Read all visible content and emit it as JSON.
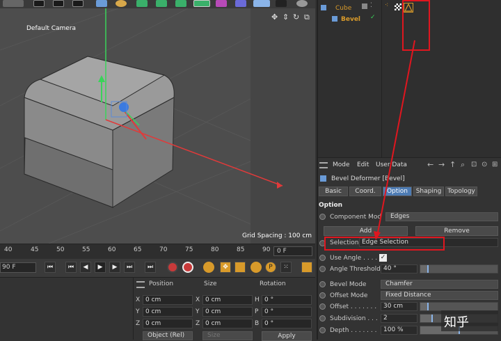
{
  "viewport": {
    "camera_label": "Default Camera",
    "grid_spacing": "Grid Spacing : 100 cm"
  },
  "timeline": {
    "ticks": [
      "40",
      "45",
      "50",
      "55",
      "60",
      "65",
      "70",
      "75",
      "80",
      "85",
      "90"
    ],
    "current_frame": "0 F",
    "start_frame": "90 F"
  },
  "coordinates": {
    "headers": {
      "position": "Position",
      "size": "Size",
      "rotation": "Rotation"
    },
    "rows": [
      {
        "axis": "X",
        "pos": "0 cm",
        "size_axis": "X",
        "size": "0 cm",
        "rot_axis": "H",
        "rot": "0 °"
      },
      {
        "axis": "Y",
        "pos": "0 cm",
        "size_axis": "Y",
        "size": "0 cm",
        "rot_axis": "P",
        "rot": "0 °"
      },
      {
        "axis": "Z",
        "pos": "0 cm",
        "size_axis": "Z",
        "size": "0 cm",
        "rot_axis": "B",
        "rot": "0 °"
      }
    ],
    "mode_dropdown": "Object (Rel)",
    "size_dropdown": "Size",
    "apply_button": "Apply"
  },
  "objects": {
    "cube": "Cube",
    "bevel": "Bevel"
  },
  "attributes": {
    "menu": [
      "Mode",
      "Edit",
      "User Data"
    ],
    "title": "Bevel Deformer [Bevel]",
    "tabs": [
      "Basic",
      "Coord.",
      "Option",
      "Shaping",
      "Topology"
    ],
    "active_tab": "Option",
    "section": "Option",
    "component_mode_label": "Component Mod",
    "component_mode_value": "Edges",
    "add_button": "Add",
    "remove_button": "Remove",
    "selection_label": "Selection",
    "selection_value": "Edge Selection",
    "use_angle_label": "Use Angle . . . .",
    "angle_threshold_label": "Angle Threshold",
    "angle_threshold_value": "40 °",
    "bevel_mode_label": "Bevel Mode",
    "bevel_mode_value": "Chamfer",
    "offset_mode_label": "Offset Mode",
    "offset_mode_value": "Fixed Distance",
    "offset_label": "Offset . . . . . . .",
    "offset_value": "30 cm",
    "subdivision_label": "Subdivision . . .",
    "subdivision_value": "2",
    "depth_label": "Depth . . . . . . .",
    "depth_value": "100 %",
    "use_angle_checked": true,
    "angle_slider_fraction": 0.1,
    "offset_slider_fraction": 0.1,
    "subdivision_slider_fraction": 0.15,
    "depth_slider_fraction": 0.5
  },
  "watermark": "知乎",
  "colors": {
    "highlight_red": "#e0161f",
    "active_tab_blue": "#4d7bb3",
    "x_axis": "#e03a3a",
    "y_axis": "#3ad35a",
    "z_axis": "#3a7ae0"
  }
}
